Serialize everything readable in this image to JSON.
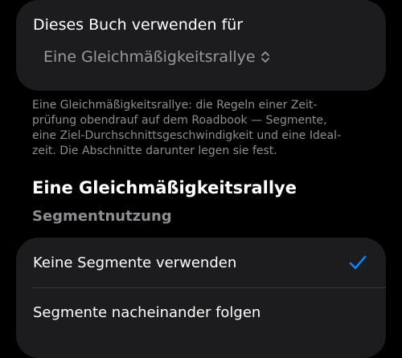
{
  "usage_card": {
    "title": "Dieses Buch verwenden für",
    "selected_value": "Eine Gleichmäßigkeitsrallye",
    "picker_icon": "chevron-up-down-icon"
  },
  "footnote": {
    "lines": [
      "Eine Gleichmäßigkeitsrallye: die Regeln einer Zeit-",
      "prüfung obendrauf auf dem Roadbook — Segmente,",
      "eine Ziel-Durchschnittsgeschwindigkeit und eine Ideal-",
      "zeit. Die Abschnitte darunter legen sie fest."
    ]
  },
  "section": {
    "title": "Eine Gleichmäßigkeitsrallye",
    "subtitle": "Segmentnutzung"
  },
  "segment_options": {
    "items": [
      {
        "label": "Keine Segmente verwenden",
        "selected": true
      },
      {
        "label": "Segmente nacheinander folgen",
        "selected": false
      }
    ],
    "check_icon": "checkmark-icon",
    "accent_color": "#0a84ff"
  }
}
